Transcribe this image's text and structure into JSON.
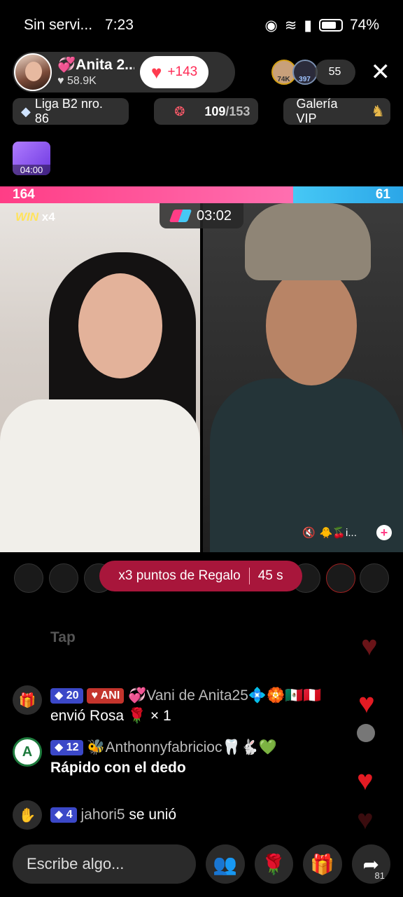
{
  "status": {
    "carrier": "Sin servi...",
    "time": "7:23",
    "battery": "74%"
  },
  "host": {
    "name": "💞Anita 2...",
    "likes": "♥ 58.9K",
    "like_count": "+143"
  },
  "viewers": {
    "avatar_1_badge": "74K",
    "avatar_2_badge": "397",
    "count": "55"
  },
  "tags": {
    "league": "Liga B2 nro. 86",
    "goal_current": "109",
    "goal_total": "/153",
    "goal_fraction": 0.712,
    "vip": "Galería VIP"
  },
  "gift_timer": "04:00",
  "pk": {
    "left_score": "164",
    "right_score": "61",
    "left_fraction": 0.728,
    "timer": "03:02",
    "win_label": "WIN",
    "win_streak": "x4",
    "opponent_tag": "🐥🍒i..."
  },
  "bonus": {
    "text": "x3 puntos de Regalo",
    "seconds": "45 s"
  },
  "chat": {
    "ghost": "Tap",
    "msg1_level": "20",
    "msg1_badge": "ANI",
    "msg1_user": "💞Vani de Anita25💠🏵️🇲🇽🇵🇪",
    "msg1_text": "envió Rosa 🌹 × 1",
    "msg2_avatar": "A",
    "msg2_level": "12",
    "msg2_user": "🐝Anthonnyfabricioc🦷🐇💚",
    "msg2_text": "Rápido con el dedo",
    "msg3_level": "4",
    "msg3_user": "jahori5",
    "msg3_text": "se unió"
  },
  "input": {
    "placeholder": "Escribe algo..."
  },
  "share_count": "81",
  "colors": {
    "pk_pink": "#ff3d86",
    "pk_blue": "#46c8f5",
    "bonus": "#a8163b",
    "heart": "#e31b23"
  }
}
